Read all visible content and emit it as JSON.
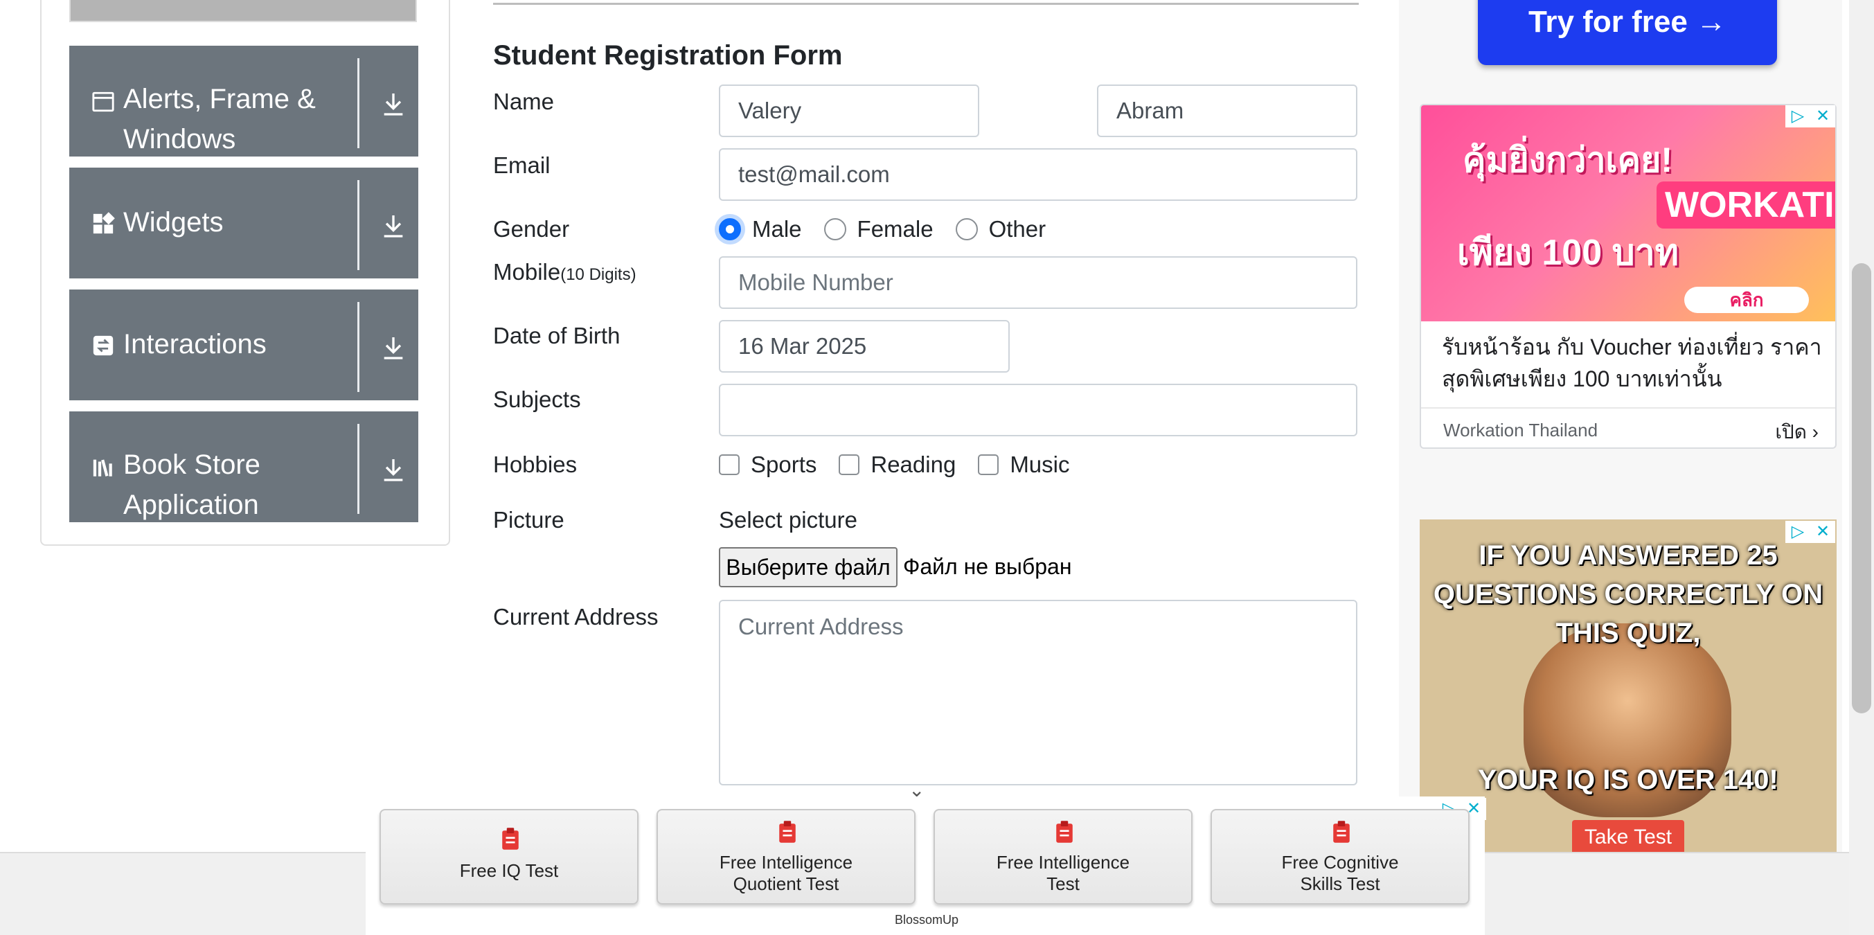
{
  "sidebar": {
    "items": [
      {
        "label_line1": "Alerts, Frame &",
        "label_line2": "Windows",
        "icon": "window-icon"
      },
      {
        "label_line1": "Widgets",
        "label_line2": "",
        "icon": "grid-icon"
      },
      {
        "label_line1": "Interactions",
        "label_line2": "",
        "icon": "swap-icon"
      },
      {
        "label_line1": "Book Store",
        "label_line2": "Application",
        "icon": "books-icon"
      }
    ]
  },
  "form": {
    "title": "Student Registration Form",
    "name_label": "Name",
    "first_name_value": "Valery",
    "last_name_value": "Abram",
    "email_label": "Email",
    "email_value": "test@mail.com",
    "gender_label": "Gender",
    "gender_options": [
      "Male",
      "Female",
      "Other"
    ],
    "gender_selected": "Male",
    "mobile_label": "Mobile",
    "mobile_hint": "(10 Digits)",
    "mobile_placeholder": "Mobile Number",
    "dob_label": "Date of Birth",
    "dob_value": "16 Mar 2025",
    "subjects_label": "Subjects",
    "subjects_value": "",
    "hobbies_label": "Hobbies",
    "hobbies": [
      "Sports",
      "Reading",
      "Music"
    ],
    "picture_label": "Picture",
    "select_picture_label": "Select picture",
    "file_button_label": "Выберите файл",
    "file_status": "Файл не выбран",
    "address_label": "Current Address",
    "address_placeholder": "Current Address"
  },
  "right_rail": {
    "try_button": "Try for free →",
    "ad1": {
      "headline": "คุ้มยิ่งกว่าเคย!",
      "price": "เพียง 100 บาท",
      "badge": "WORKATION",
      "click": "คลิก",
      "text": "รับหน้าร้อน กับ Voucher ท่องเที่ยว ราคาสุดพิเศษเพียง 100 บาทเท่านั้น",
      "advertiser": "Workation Thailand",
      "open": "เปิด"
    },
    "ad2": {
      "question": "IF YOU ANSWERED 25 QUESTIONS CORRECTLY ON THIS QUIZ,",
      "result": "YOUR IQ IS OVER 140!",
      "cta": "Take Test"
    }
  },
  "bottom_ad": {
    "tiles": [
      {
        "line1": "Free IQ Test",
        "line2": ""
      },
      {
        "line1": "Free Intelligence",
        "line2": "Quotient Test"
      },
      {
        "line1": "Free Intelligence",
        "line2": "Test"
      },
      {
        "line1": "Free Cognitive",
        "line2": "Skills Test"
      }
    ],
    "brand": "BlossomUp"
  },
  "colors": {
    "sidebar_item_bg": "#6c757d",
    "radio_accent": "#0d6efd",
    "try_button_bg": "#1d3cf0"
  }
}
